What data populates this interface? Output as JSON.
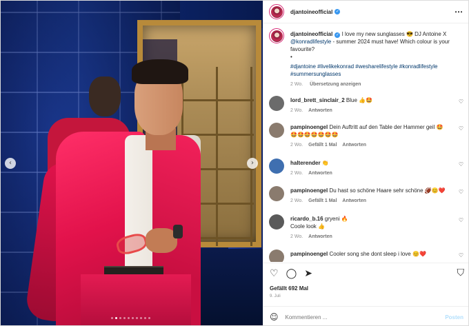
{
  "post": {
    "username": "djantoineofficial",
    "verified_mark": "✓",
    "more_icon": "⋯",
    "caption": {
      "username": "djantoineofficial",
      "text_before": " I love my new sunglasses 😎 DJ Antoine X ",
      "mention": "@konradlifestyle",
      "text_after": " - summer 2024 must have! Which colour is your favourite?",
      "bullet": "•",
      "hashtags": "#djantoine #livelikekonrad #wesharelifestyle #konradlifestyle #summersunglasses",
      "time": "2 Wo.",
      "translate": "Übersetzung anzeigen"
    },
    "comments": [
      {
        "user": "lord_brett_sinclair_2",
        "text": " Blue 👍🤩",
        "time": "2 Wo.",
        "likes": "",
        "reply": "Antworten",
        "avatar_color": "#6b6b6b"
      },
      {
        "user": "pampinoengel",
        "text": " Dein Auftritt auf den Table der Hammer geil 🤩",
        "text2": "🤩🤩🤩🤩🤩🤩🤩",
        "time": "2 Wo.",
        "likes": "Gefällt 1 Mal",
        "reply": "Antworten",
        "avatar_color": "#8a7b6e"
      },
      {
        "user": "halterender",
        "text": " 👏",
        "time": "2 Wo.",
        "likes": "",
        "reply": "Antworten",
        "avatar_color": "#3f6fb0"
      },
      {
        "user": "pampinoengel",
        "text": " Du hast so schöne Haare sehr schöne 🏈😊❤️",
        "time": "2 Wo.",
        "likes": "Gefällt 1 Mal",
        "reply": "Antworten",
        "avatar_color": "#8a7b6e"
      },
      {
        "user": "ricardo_b.16",
        "text": " gryeni 🔥",
        "text2": "Coole look 👍",
        "time": "2 Wo.",
        "likes": "",
        "reply": "Antworten",
        "avatar_color": "#5a5a5a"
      },
      {
        "user": "pampinoengel",
        "text": " Cooler song she dont sleep i love 😊❤️",
        "time": "",
        "likes": "",
        "reply": "",
        "avatar_color": "#8a7b6e"
      }
    ],
    "like_icon": "♡",
    "likes_count": "Gefällt 692 Mal",
    "date": "9. Juli",
    "comment_placeholder": "Kommentieren ...",
    "post_button": "Posten",
    "icons": {
      "heart": "♡",
      "comment": "◯",
      "share": "➤",
      "bookmark": "⛉",
      "emoji": "☺",
      "prev": "‹",
      "next": "›"
    },
    "media": {
      "slides": 10,
      "active_slide": 2
    }
  }
}
